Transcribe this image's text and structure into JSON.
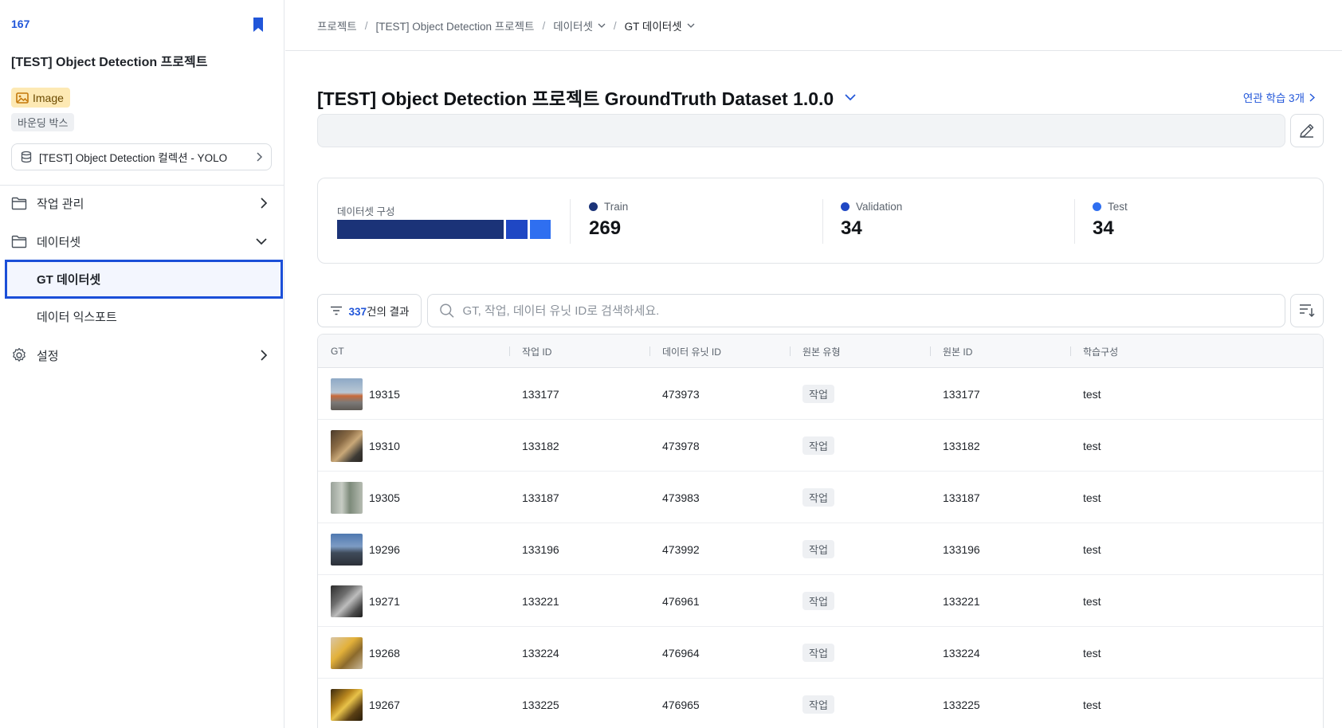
{
  "sidebar": {
    "project_id": "167",
    "project_title": "[TEST] Object Detection 프로젝트",
    "badge_image": "Image",
    "badge_annotation": "바운딩 박스",
    "collection_label": "[TEST] Object Detection 컬렉션 - YOLO",
    "nav": {
      "tasks": "작업 관리",
      "datasets": "데이터셋",
      "gt_dataset": "GT 데이터셋",
      "data_export": "데이터 익스포트",
      "settings": "설정"
    }
  },
  "breadcrumb": {
    "item1": "프로젝트",
    "item2": "[TEST] Object Detection 프로젝트",
    "item3": "데이터셋",
    "item4": "GT 데이터셋"
  },
  "dataset": {
    "title": "[TEST] Object Detection 프로젝트 GroundTruth Dataset 1.0.0",
    "related_link": "연관 학습 3개",
    "description": ""
  },
  "composition": {
    "label": "데이터셋 구성",
    "splits": {
      "train": {
        "label": "Train",
        "count": "269",
        "value": 269,
        "color": "#1b3378"
      },
      "validation": {
        "label": "Validation",
        "count": "34",
        "value": 34,
        "color": "#1f47c4"
      },
      "test": {
        "label": "Test",
        "count": "34",
        "value": 34,
        "color": "#2f6ff0"
      }
    }
  },
  "toolbar": {
    "result_count": "337",
    "result_suffix": "건의 결과",
    "search_placeholder": "GT, 작업, 데이터 유닛 ID로 검색하세요."
  },
  "table": {
    "columns": {
      "gt": "GT",
      "task_id": "작업 ID",
      "unit_id": "데이터 유닛 ID",
      "source_type": "원본 유형",
      "source_id": "원본 ID",
      "split": "학습구성"
    },
    "rows": [
      {
        "gt": "19315",
        "task_id": "133177",
        "unit_id": "473973",
        "source_type": "작업",
        "source_id": "133177",
        "split": "test"
      },
      {
        "gt": "19310",
        "task_id": "133182",
        "unit_id": "473978",
        "source_type": "작업",
        "source_id": "133182",
        "split": "test"
      },
      {
        "gt": "19305",
        "task_id": "133187",
        "unit_id": "473983",
        "source_type": "작업",
        "source_id": "133187",
        "split": "test"
      },
      {
        "gt": "19296",
        "task_id": "133196",
        "unit_id": "473992",
        "source_type": "작업",
        "source_id": "133196",
        "split": "test"
      },
      {
        "gt": "19271",
        "task_id": "133221",
        "unit_id": "476961",
        "source_type": "작업",
        "source_id": "133221",
        "split": "test"
      },
      {
        "gt": "19268",
        "task_id": "133224",
        "unit_id": "476964",
        "source_type": "작업",
        "source_id": "133224",
        "split": "test"
      },
      {
        "gt": "19267",
        "task_id": "133225",
        "unit_id": "476965",
        "source_type": "작업",
        "source_id": "133225",
        "split": "test"
      }
    ]
  }
}
